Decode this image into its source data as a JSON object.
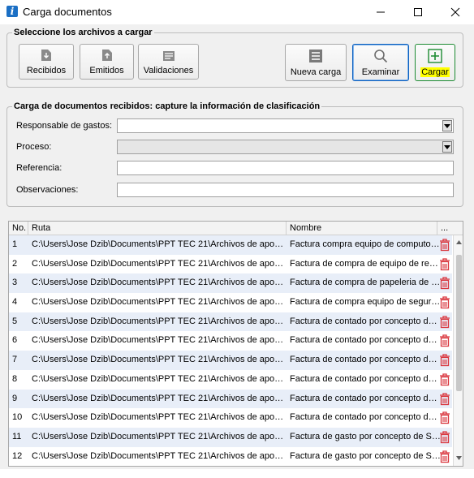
{
  "window": {
    "title": "Carga documentos"
  },
  "file_group": {
    "legend": "Seleccione los archivos a cargar",
    "buttons": {
      "recibidos": "Recibidos",
      "emitidos": "Emitidos",
      "validaciones": "Validaciones",
      "nueva_carga": "Nueva carga",
      "examinar": "Examinar",
      "cargar": "Cargar"
    }
  },
  "class_group": {
    "legend": "Carga de documentos recibidos: capture la información de clasificación",
    "responsable": {
      "label": "Responsable de gastos:",
      "value": ""
    },
    "proceso": {
      "label": "Proceso:",
      "value": ""
    },
    "referencia": {
      "label": "Referencia:",
      "value": ""
    },
    "observaciones": {
      "label": "Observaciones:",
      "value": ""
    }
  },
  "grid": {
    "headers": {
      "no": "No.",
      "ruta": "Ruta",
      "nombre": "Nombre",
      "more": "..."
    },
    "rows": [
      {
        "no": "1",
        "ruta": "C:\\Users\\Jose Dzib\\Documents\\PPT TEC 21\\Archivos de apoyo caso ...",
        "nombre": "Factura compra equipo de computo co..."
      },
      {
        "no": "2",
        "ruta": "C:\\Users\\Jose Dzib\\Documents\\PPT TEC 21\\Archivos de apoyo caso ...",
        "nombre": "Factura de compra de equipo de repart..."
      },
      {
        "no": "3",
        "ruta": "C:\\Users\\Jose Dzib\\Documents\\PPT TEC 21\\Archivos de apoyo caso ...",
        "nombre": "Factura de compra de papeleria de ofic..."
      },
      {
        "no": "4",
        "ruta": "C:\\Users\\Jose Dzib\\Documents\\PPT TEC 21\\Archivos de apoyo caso ...",
        "nombre": "Factura de compra equipo de segurida..."
      },
      {
        "no": "5",
        "ruta": "C:\\Users\\Jose Dzib\\Documents\\PPT TEC 21\\Archivos de apoyo caso ...",
        "nombre": "Factura de contado por concepto de m..."
      },
      {
        "no": "6",
        "ruta": "C:\\Users\\Jose Dzib\\Documents\\PPT TEC 21\\Archivos de apoyo caso ...",
        "nombre": "Factura de contado por concepto de m..."
      },
      {
        "no": "7",
        "ruta": "C:\\Users\\Jose Dzib\\Documents\\PPT TEC 21\\Archivos de apoyo caso ...",
        "nombre": "Factura de contado por concepto de se..."
      },
      {
        "no": "8",
        "ruta": "C:\\Users\\Jose Dzib\\Documents\\PPT TEC 21\\Archivos de apoyo caso ...",
        "nombre": "Factura de contado por concepto de se..."
      },
      {
        "no": "9",
        "ruta": "C:\\Users\\Jose Dzib\\Documents\\PPT TEC 21\\Archivos de apoyo caso ...",
        "nombre": "Factura de contado por concepto de se..."
      },
      {
        "no": "10",
        "ruta": "C:\\Users\\Jose Dzib\\Documents\\PPT TEC 21\\Archivos de apoyo caso ...",
        "nombre": "Factura de contado por concepto de se..."
      },
      {
        "no": "11",
        "ruta": "C:\\Users\\Jose Dzib\\Documents\\PPT TEC 21\\Archivos de apoyo caso ...",
        "nombre": "Factura de gasto por concepto de Servi..."
      },
      {
        "no": "12",
        "ruta": "C:\\Users\\Jose Dzib\\Documents\\PPT TEC 21\\Archivos de apoyo caso ...",
        "nombre": "Factura de gasto por concepto de Servi..."
      }
    ]
  },
  "colors": {
    "accent": "#1b6fc4",
    "delete_icon": "#d9363e",
    "cargar_green": "#1d8b32",
    "highlight": "#ffff00",
    "alt_row": "#e8eef8"
  },
  "icons": [
    "app-icon",
    "minimize-icon",
    "maximize-icon",
    "close-icon",
    "download-doc-icon",
    "upload-doc-icon",
    "validate-doc-icon",
    "new-load-icon",
    "search-icon",
    "add-icon",
    "trash-icon"
  ]
}
